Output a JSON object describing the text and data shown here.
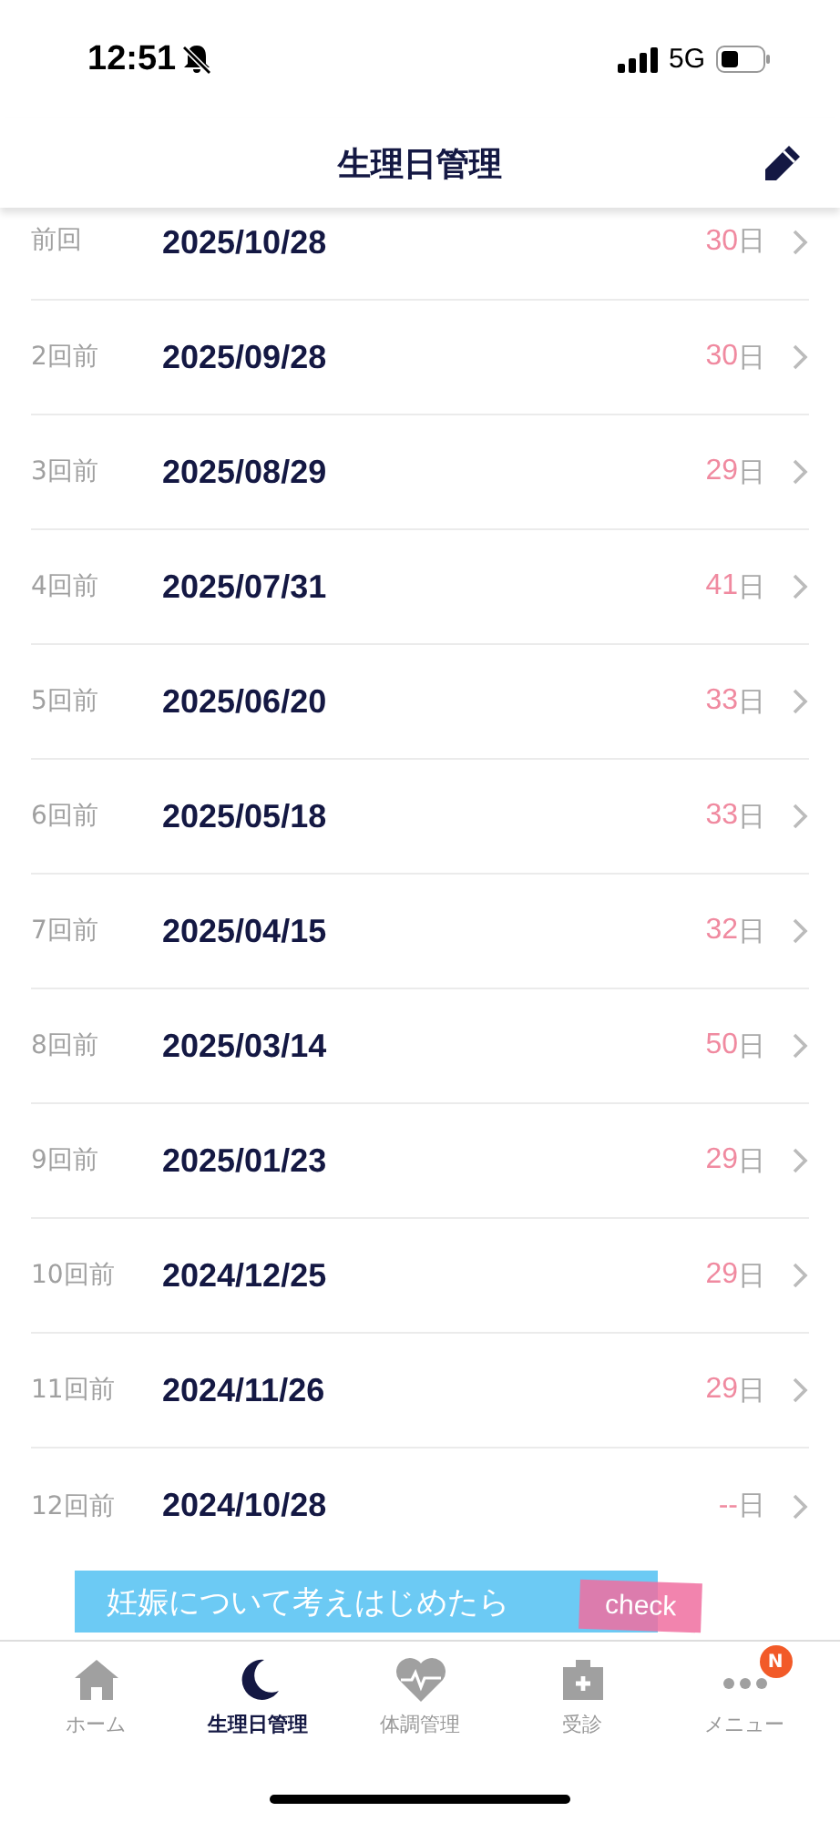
{
  "status_bar": {
    "time": "12:51",
    "network": "5G"
  },
  "header": {
    "title": "生理日管理"
  },
  "records": [
    {
      "label": "前回",
      "date": "2025/10/28",
      "days": "30",
      "unit": "日"
    },
    {
      "label": "2回前",
      "date": "2025/09/28",
      "days": "30",
      "unit": "日"
    },
    {
      "label": "3回前",
      "date": "2025/08/29",
      "days": "29",
      "unit": "日"
    },
    {
      "label": "4回前",
      "date": "2025/07/31",
      "days": "41",
      "unit": "日"
    },
    {
      "label": "5回前",
      "date": "2025/06/20",
      "days": "33",
      "unit": "日"
    },
    {
      "label": "6回前",
      "date": "2025/05/18",
      "days": "33",
      "unit": "日"
    },
    {
      "label": "7回前",
      "date": "2025/04/15",
      "days": "32",
      "unit": "日"
    },
    {
      "label": "8回前",
      "date": "2025/03/14",
      "days": "50",
      "unit": "日"
    },
    {
      "label": "9回前",
      "date": "2025/01/23",
      "days": "29",
      "unit": "日"
    },
    {
      "label": "10回前",
      "date": "2024/12/25",
      "days": "29",
      "unit": "日"
    },
    {
      "label": "11回前",
      "date": "2024/11/26",
      "days": "29",
      "unit": "日"
    },
    {
      "label": "12回前",
      "date": "2024/10/28",
      "days": "--",
      "unit": "日"
    }
  ],
  "banner": {
    "text": "妊娠について考えはじめたら",
    "action": "check"
  },
  "tabs": [
    {
      "kind": "home",
      "label": "ホーム",
      "selected": false
    },
    {
      "kind": "moon",
      "label": "生理日管理",
      "selected": true
    },
    {
      "kind": "heart",
      "label": "体調管理",
      "selected": false
    },
    {
      "kind": "clinic",
      "label": "受診",
      "selected": false
    },
    {
      "kind": "menu",
      "label": "メニュー",
      "selected": false,
      "badge": "N"
    }
  ]
}
